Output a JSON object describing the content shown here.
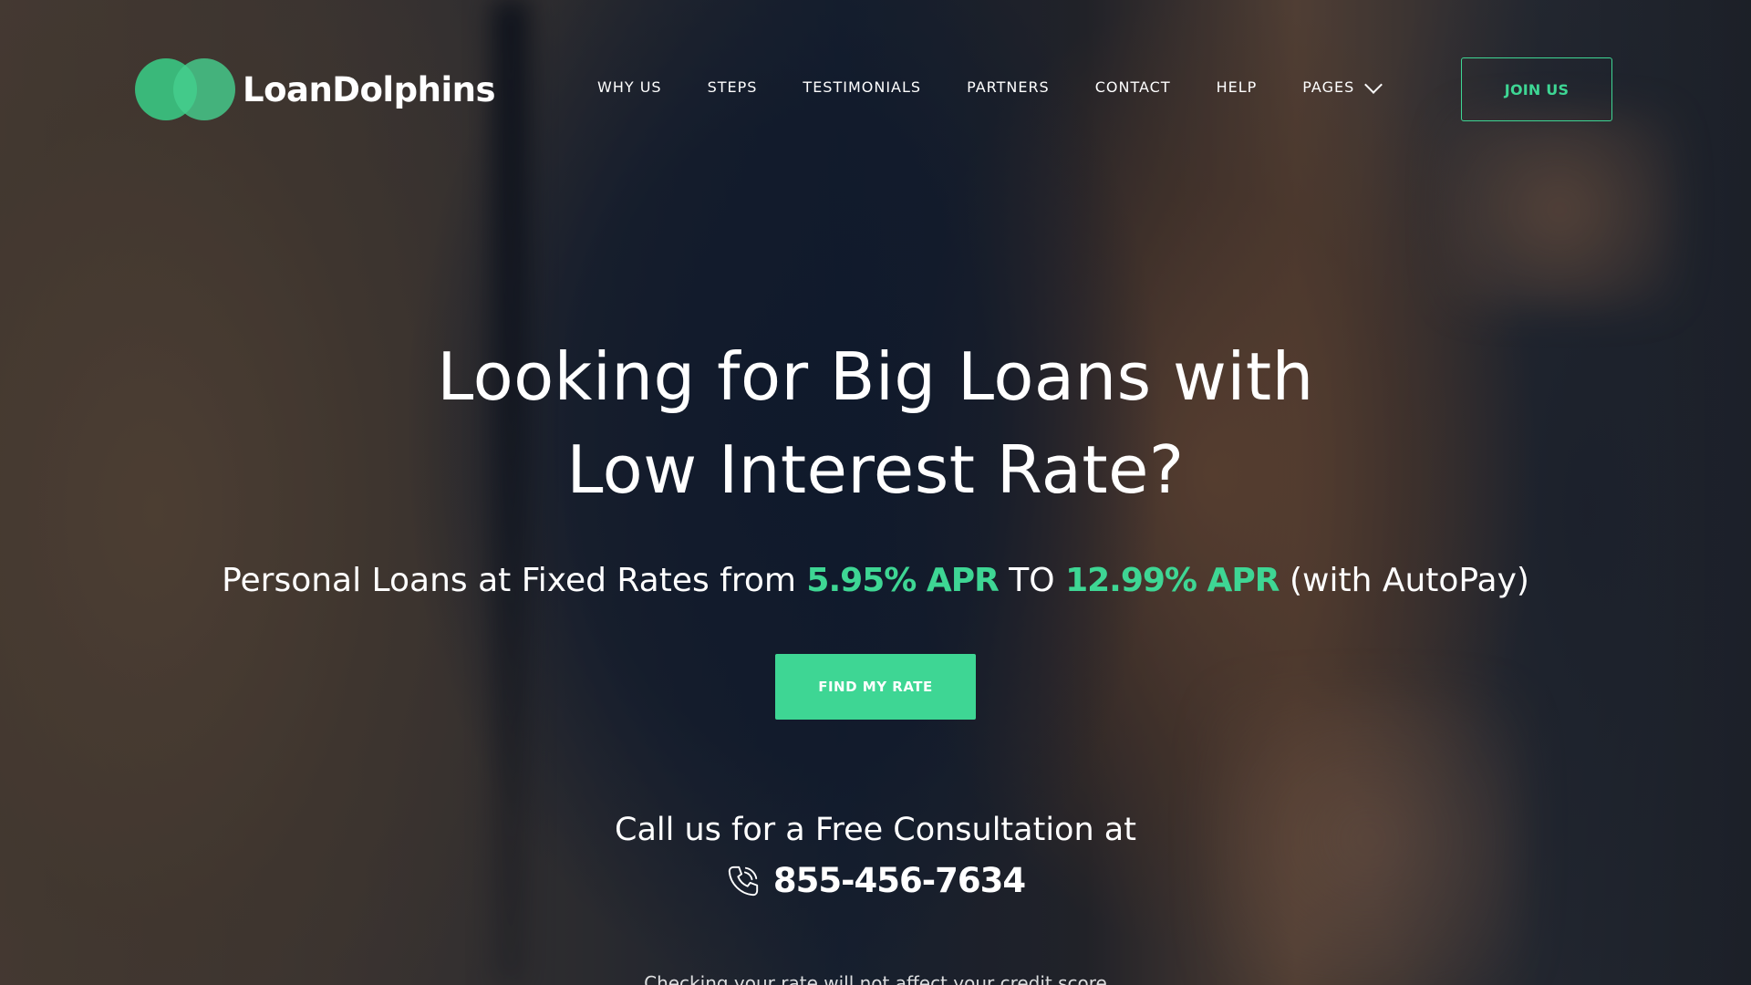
{
  "brand": {
    "name": "LoanDolphins",
    "accent_color": "#3ed694"
  },
  "nav": {
    "items": [
      {
        "label": "WHY US"
      },
      {
        "label": "STEPS"
      },
      {
        "label": "TESTIMONIALS"
      },
      {
        "label": "PARTNERS"
      },
      {
        "label": "CONTACT"
      },
      {
        "label": "HELP"
      },
      {
        "label": "PAGES",
        "icon": "chevron-down-icon"
      }
    ],
    "join_label": "JOIN US"
  },
  "hero": {
    "title_line1": "Looking for Big Loans with",
    "title_line2": "Low Interest Rate?",
    "sub_prefix": "Personal Loans at Fixed Rates from",
    "rate_low": "5.95% APR",
    "sub_mid": "TO",
    "rate_high": "12.99% APR",
    "sub_suffix": "(with AutoPay)",
    "cta_label": "FIND MY RATE",
    "call_text": "Call us for a Free Consultation at",
    "phone_icon": "phone-icon",
    "phone": "855-456-7634",
    "disclaimer": "Checking your rate will not affect your credit score"
  }
}
